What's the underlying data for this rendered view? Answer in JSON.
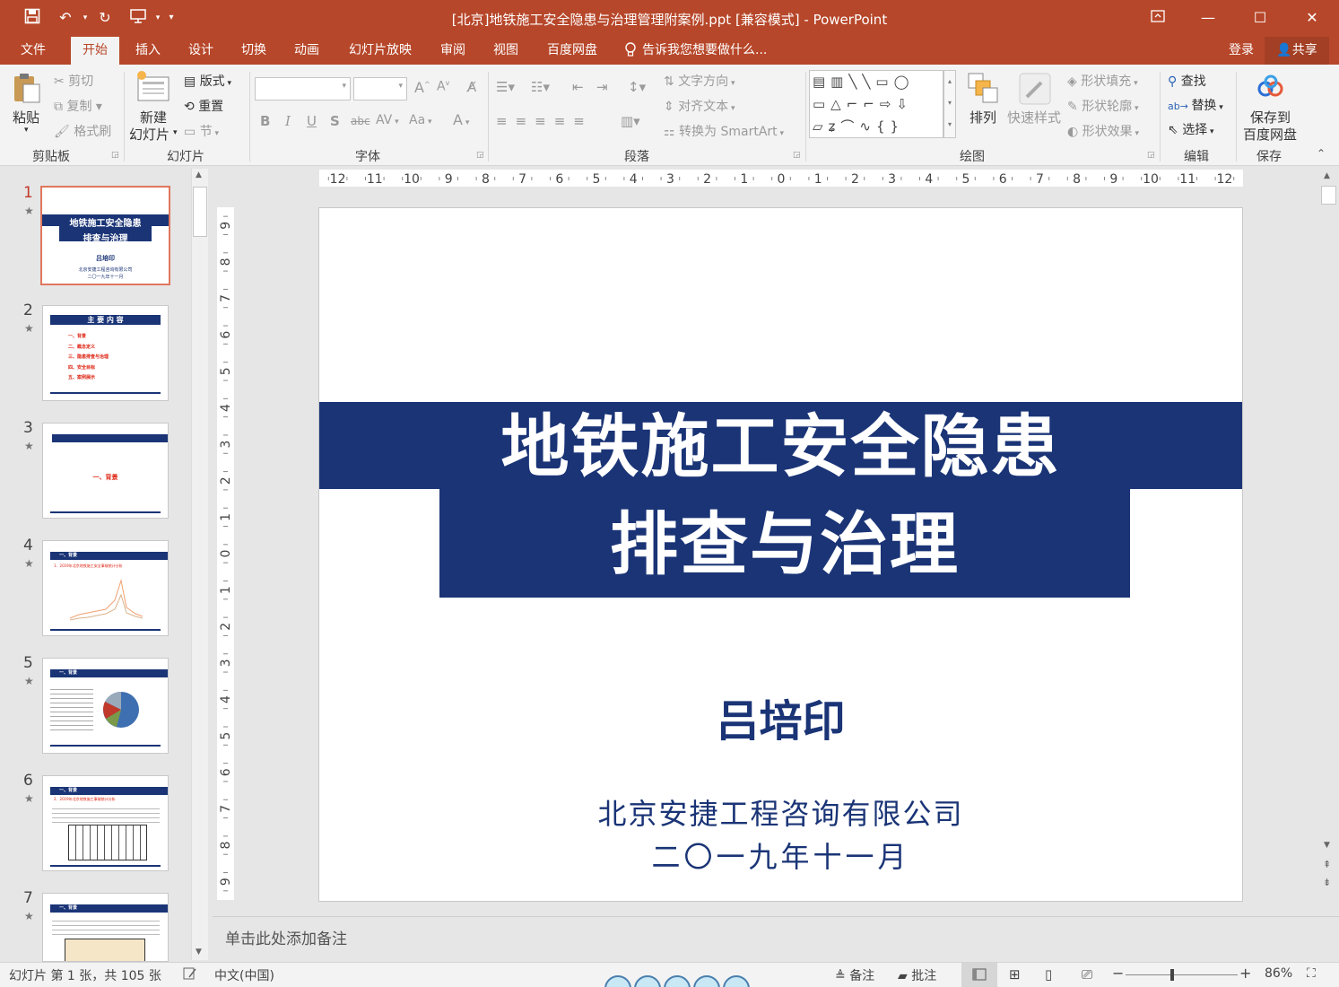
{
  "window": {
    "title": "[北京]地铁施工安全隐患与治理管理附案例.ppt [兼容模式] - PowerPoint"
  },
  "tabs": {
    "file": "文件",
    "home": "开始",
    "insert": "插入",
    "design": "设计",
    "transitions": "切换",
    "animations": "动画",
    "slideshow": "幻灯片放映",
    "review": "审阅",
    "view": "视图",
    "baidu": "百度网盘",
    "tellme": "告诉我您想要做什么...",
    "login": "登录",
    "share": "共享"
  },
  "ribbon": {
    "clipboard": {
      "paste": "粘贴",
      "cut": "剪切",
      "copy": "复制",
      "format_painter": "格式刷",
      "label": "剪贴板"
    },
    "slides": {
      "new_slide_1": "新建",
      "new_slide_2": "幻灯片",
      "layout": "版式",
      "reset": "重置",
      "section": "节",
      "label": "幻灯片"
    },
    "font": {
      "label": "字体",
      "bold": "B",
      "italic": "I",
      "underline": "U",
      "shadow": "S",
      "strike": "abc",
      "spacing": "AV",
      "case": "Aa",
      "color": "A",
      "grow": "A",
      "shrink": "A"
    },
    "paragraph": {
      "text_direction": "文字方向",
      "align_text": "对齐文本",
      "smartart": "转换为 SmartArt",
      "label": "段落"
    },
    "drawing": {
      "arrange": "排列",
      "quick_styles": "快速样式",
      "shape_fill": "形状填充",
      "shape_outline": "形状轮廓",
      "shape_effects": "形状效果",
      "label": "绘图"
    },
    "editing": {
      "find": "查找",
      "replace": "替换",
      "select": "选择",
      "label": "编辑"
    },
    "save": {
      "save_1": "保存到",
      "save_2": "百度网盘",
      "label": "保存"
    }
  },
  "ruler": {
    "h_ticks": [
      "12",
      "11",
      "10",
      "9",
      "8",
      "7",
      "6",
      "5",
      "4",
      "3",
      "2",
      "1",
      "0",
      "1",
      "2",
      "3",
      "4",
      "5",
      "6",
      "7",
      "8",
      "9",
      "10",
      "11",
      "12"
    ],
    "v_ticks": [
      "9",
      "8",
      "7",
      "6",
      "5",
      "4",
      "3",
      "2",
      "1",
      "0",
      "1",
      "2",
      "3",
      "4",
      "5",
      "6",
      "7",
      "8",
      "9"
    ]
  },
  "thumbnails": [
    {
      "num": "1",
      "t1": "地铁施工安全隐患",
      "t2": "排查与治理",
      "name": "吕培印",
      "org": "北京安捷工程咨询有限公司",
      "date": "二〇一九年十一月"
    },
    {
      "num": "2",
      "header": "主 要 内 容",
      "items": [
        "一、背景",
        "二、概念定义",
        "三、隐患排查与治理",
        "四、安全目标",
        "五、案例展示"
      ]
    },
    {
      "num": "3",
      "center": "一、背景"
    },
    {
      "num": "4",
      "header": "一、背景",
      "sub": "1．2019年北京地铁施工安全事故统计分析"
    },
    {
      "num": "5",
      "header": "一、背景"
    },
    {
      "num": "6",
      "header": "一、背景",
      "sub": "2．2019年北京地铁施工事故统计分析"
    },
    {
      "num": "7",
      "header": "一、背景"
    }
  ],
  "slide": {
    "title_line1": "地铁施工安全隐患",
    "title_line2": "排查与治理",
    "author": "吕培印",
    "org": "北京安捷工程咨询有限公司",
    "date": "二〇一九年十一月"
  },
  "notes": {
    "placeholder": "单击此处添加备注"
  },
  "status": {
    "slide_info": "幻灯片 第 1 张，共 105 张",
    "language": "中文(中国)",
    "notes_btn": "备注",
    "comments_btn": "批注",
    "zoom": "86%"
  },
  "colors": {
    "accent": "#b7472a",
    "title_band": "#1a3476"
  }
}
